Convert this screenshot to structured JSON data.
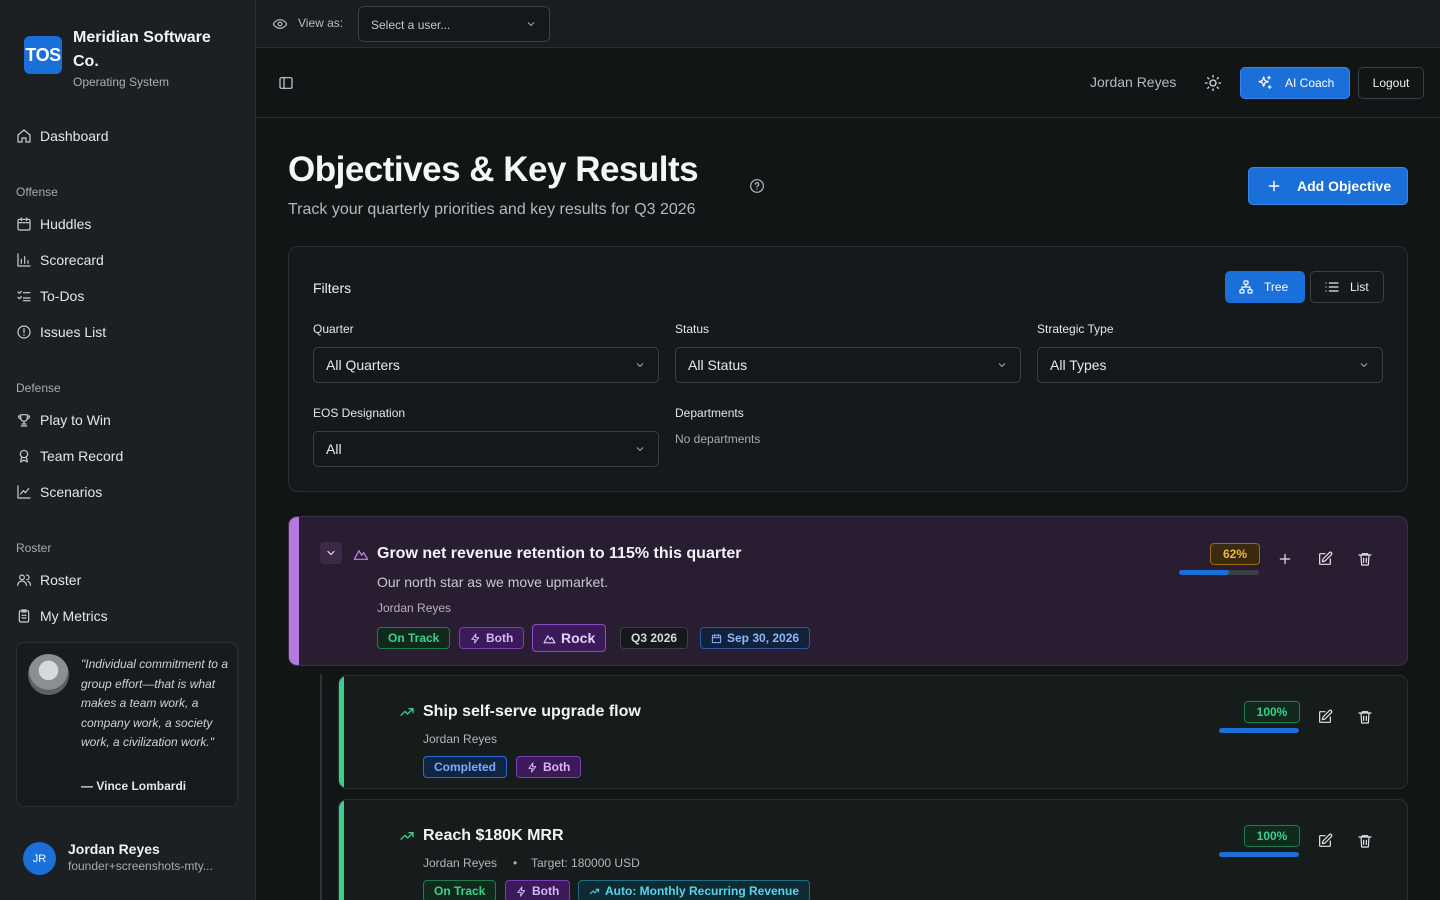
{
  "brand": {
    "logo": "TOS",
    "name": "Meridian Software Co.",
    "subtitle": "Operating System"
  },
  "sidebar": {
    "dashboard": "Dashboard",
    "sections": [
      {
        "title": "Offense",
        "items": [
          {
            "label": "Huddles",
            "icon": "calendar-icon"
          },
          {
            "label": "Scorecard",
            "icon": "bar-chart-icon"
          },
          {
            "label": "To-Dos",
            "icon": "checklist-icon"
          },
          {
            "label": "Issues List",
            "icon": "alert-circle-icon"
          }
        ]
      },
      {
        "title": "Defense",
        "items": [
          {
            "label": "Play to Win",
            "icon": "trophy-icon"
          },
          {
            "label": "Team Record",
            "icon": "award-icon"
          },
          {
            "label": "Scenarios",
            "icon": "line-chart-icon"
          }
        ]
      },
      {
        "title": "Roster",
        "items": [
          {
            "label": "Roster",
            "icon": "users-icon"
          },
          {
            "label": "My Metrics",
            "icon": "clipboard-icon"
          }
        ]
      }
    ],
    "quote": {
      "text": "\"Individual commitment to a group effort—that is what makes a team work, a company work, a society work, a civilization work.\"",
      "author": "— Vince Lombardi"
    },
    "user": {
      "initials": "JR",
      "name": "Jordan Reyes",
      "email": "founder+screenshots-mty..."
    }
  },
  "viewas": {
    "label": "View as:",
    "placeholder": "Select a user..."
  },
  "header": {
    "user": "Jordan Reyes",
    "ai_coach": "AI Coach",
    "logout": "Logout"
  },
  "page": {
    "title": "Objectives & Key Results",
    "subtitle": "Track your quarterly priorities and key results for Q3 2026",
    "add_button": "Add Objective"
  },
  "filters": {
    "title": "Filters",
    "view_tree": "Tree",
    "view_list": "List",
    "quarter": {
      "label": "Quarter",
      "value": "All Quarters"
    },
    "status": {
      "label": "Status",
      "value": "All Status"
    },
    "strategic_type": {
      "label": "Strategic Type",
      "value": "All Types"
    },
    "eos": {
      "label": "EOS Designation",
      "value": "All"
    },
    "departments": {
      "label": "Departments",
      "empty": "No departments"
    }
  },
  "objective": {
    "title": "Grow net revenue retention to 115% this quarter",
    "description": "Our north star as we move upmarket.",
    "owner": "Jordan Reyes",
    "progress_label": "62%",
    "progress": 0.62,
    "badges": {
      "status": "On Track",
      "type": "Both",
      "eos": "Rock",
      "quarter": "Q3 2026",
      "due": "Sep 30, 2026"
    },
    "accent_color": "#b47ae0"
  },
  "key_results": [
    {
      "title": "Ship self-serve upgrade flow",
      "owner": "Jordan Reyes",
      "progress_label": "100%",
      "progress": 1.0,
      "badges": {
        "status": "Completed",
        "type": "Both"
      }
    },
    {
      "title": "Reach $180K MRR",
      "owner": "Jordan Reyes",
      "separator": "•",
      "target": "Target: 180000 USD",
      "progress_label": "100%",
      "progress": 1.0,
      "badges": {
        "status": "On Track",
        "type": "Both",
        "metric": "Auto: Monthly Recurring Revenue"
      }
    }
  ],
  "colors": {
    "accent": "#1a6fd9",
    "kr_accent": "#3ecf8e"
  }
}
